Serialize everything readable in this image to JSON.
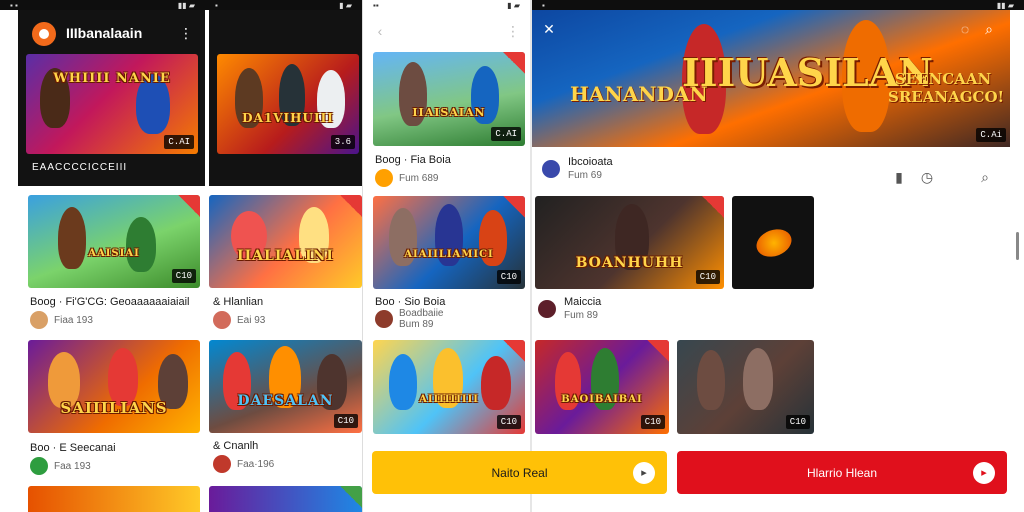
{
  "colors": {
    "accent_yellow": "#ffc107",
    "accent_red": "#e0101c",
    "dark": "#121212",
    "light_bg": "#ffffff"
  },
  "panel1": {
    "app_title": "IIIbanalaain",
    "menu_icon": "more-vert-icon",
    "section_label": "EAACCCCICCEIII",
    "thumbs": [
      {
        "title": "WHIIII NANIE",
        "duration": "C.AI"
      },
      {
        "title": "DA1VIHUIII",
        "duration": "3.6"
      }
    ],
    "videos": [
      {
        "title": "Boog · Fi'G'CG: Geoaaaaaaiaiail",
        "meta": "Fiaa 193",
        "duration": "C10"
      },
      {
        "title": "& Hlanlian",
        "meta": "Eai 93",
        "duration": "C10"
      },
      {
        "title": "Boo · E Seecanai",
        "meta": "Faa 193",
        "duration": ""
      },
      {
        "title": "& Cnanlh",
        "meta": "Faa·196",
        "duration": "C10"
      }
    ],
    "thumb_titles": [
      "AAISIAI",
      "IIALIALINI",
      "SAIIILIANS",
      "DAESALAN"
    ]
  },
  "panel3": {
    "back_icon": "chevron-left-icon",
    "thumbs": [
      {
        "title": "IIAISAIAN",
        "duration": "C.AI"
      },
      {
        "title": "AIAIILIAMICI",
        "duration": "C10"
      },
      {
        "title": "AIIIIIIIII",
        "duration": "C10"
      }
    ],
    "videos": [
      {
        "title": "Boog · Fia Boia",
        "meta": "Fum 689"
      },
      {
        "title": "Boo · Sio Boia",
        "sub": "Boadbaiie",
        "meta": "Bum 89"
      }
    ]
  },
  "panel4": {
    "hero_title": "IIIUASILAN",
    "hero_left": "HANANDAN",
    "hero_right": "SEENCAAN SREANAGCO!",
    "hero_duration": "C.Ai",
    "channel_name": "Ibcoioata",
    "channel_meta": "Fum 69",
    "channel2_name": "Maiccia",
    "channel2_meta": "Fum 89",
    "thumbs": [
      {
        "title": "BOANHUHH",
        "duration": "C10"
      },
      {
        "title": "",
        "duration": ""
      },
      {
        "title": "BAOIBAIBAI",
        "duration": "C10"
      },
      {
        "title": "",
        "duration": "C10"
      }
    ],
    "icons": {
      "bookmark": "bookmark-icon",
      "clock": "timer-icon",
      "search": "search-icon",
      "chat": "chat-icon"
    },
    "button_yellow": "Naito Real",
    "button_red": "Hlarrio Hlean",
    "button_icon": "play-icon"
  }
}
